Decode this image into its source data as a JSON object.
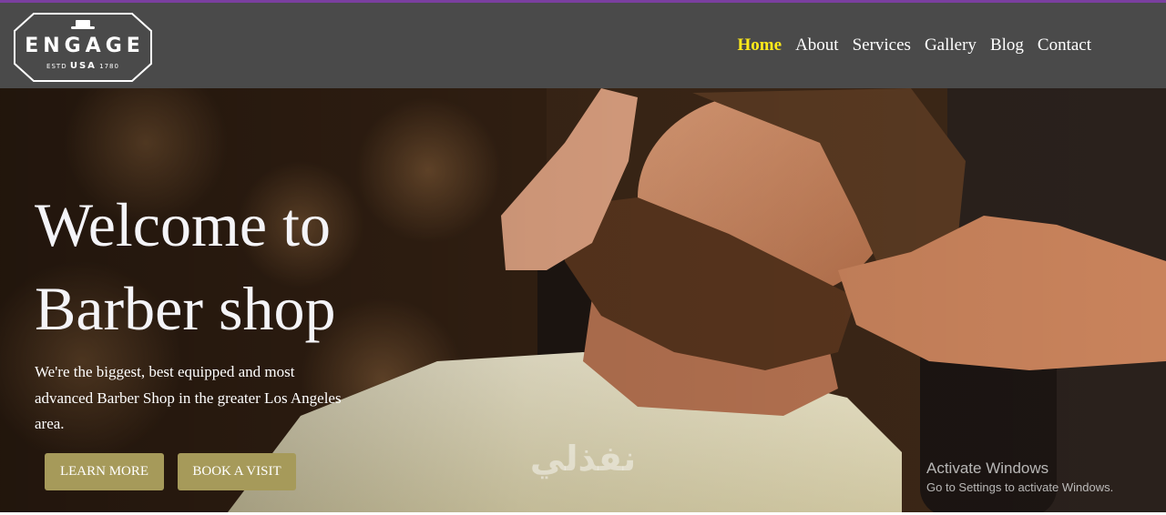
{
  "logo": {
    "name": "ENGAGE",
    "est": "ESTD",
    "country": "USA",
    "year": "1780"
  },
  "nav": {
    "items": [
      {
        "label": "Home",
        "active": true
      },
      {
        "label": "About",
        "active": false
      },
      {
        "label": "Services",
        "active": false
      },
      {
        "label": "Gallery",
        "active": false
      },
      {
        "label": "Blog",
        "active": false
      },
      {
        "label": "Contact",
        "active": false
      }
    ]
  },
  "hero": {
    "title_line1": "Welcome to",
    "title_line2": "Barber shop",
    "description": "We're the biggest, best equipped and most advanced Barber Shop in the greater Los Angeles area.",
    "learn_more": "LEARN MORE",
    "book_visit": "BOOK A VISIT"
  },
  "windows_watermark": {
    "title": "Activate Windows",
    "subtitle": "Go to Settings to activate Windows."
  },
  "site_watermark": "نفذلي",
  "colors": {
    "navbar": "#4a4a4a",
    "active_link": "#ffeb1a",
    "button": "#a69a5a",
    "accent_line": "#7b3fa0"
  },
  "icons": [
    "hat-icon"
  ]
}
